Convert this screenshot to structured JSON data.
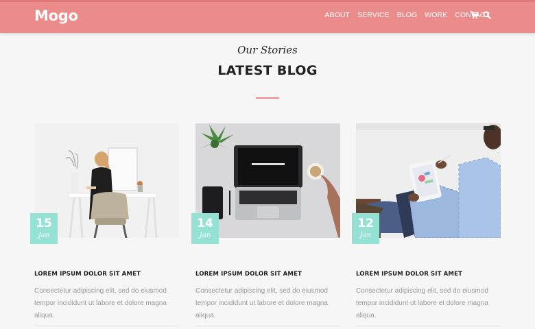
{
  "header": {
    "logo": "Mogo",
    "nav": [
      "ABOUT",
      "SERVICE",
      "BLOG",
      "WORK",
      "CONTACT"
    ],
    "icons": [
      "cart-icon",
      "search-icon"
    ]
  },
  "section": {
    "subheading": "Our Stories",
    "heading": "LATEST BLOG"
  },
  "posts": [
    {
      "day": "15",
      "month": "Jan",
      "title": "LOREM IPSUM DOLOR SIT AMET",
      "text": "Consectetur adipiscing elit, sed do eiusmod tempor incididunt ut labore et dolore magna aliqua."
    },
    {
      "day": "14",
      "month": "Jan",
      "title": "LOREM IPSUM DOLOR SIT AMET",
      "text": "Consectetur adipiscing elit, sed do eiusmod tempor incididunt ut labore et dolore magna aliqua."
    },
    {
      "day": "12",
      "month": "Jan",
      "title": "LOREM IPSUM DOLOR SIT AMET",
      "text": "Consectetur adipiscing elit, sed do eiusmod tempor incididunt ut labore et dolore magna aliqua."
    }
  ],
  "colors": {
    "brand": "#eb8b8b",
    "accent": "#95e1d3",
    "background": "#f6f6f7"
  }
}
